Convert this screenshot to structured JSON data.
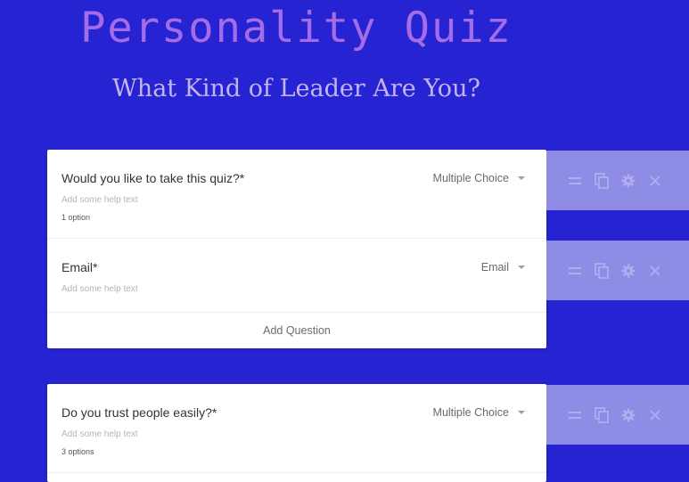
{
  "header": {
    "title": "Personality Quiz",
    "subtitle": "What Kind of Leader Are You?"
  },
  "colors": {
    "background": "#2623d2",
    "title": "#a56ce8",
    "subtitle": "#c4b3f1",
    "toolbar": "#8f8ce6",
    "toolbar_icon": "#b0aef0"
  },
  "pages": [
    {
      "questions": [
        {
          "label": "Would you like to take this quiz?*",
          "type": "Multiple Choice",
          "help_placeholder": "Add some help text",
          "count": "1 option"
        },
        {
          "label": "Email*",
          "type": "Email",
          "help_placeholder": "Add some help text",
          "count": ""
        }
      ],
      "add_question_label": "Add Question"
    },
    {
      "questions": [
        {
          "label": "Do you trust people easily?*",
          "type": "Multiple Choice",
          "help_placeholder": "Add some help text",
          "count": "3 options"
        }
      ]
    }
  ],
  "toolbar_icons": [
    "drag-handle-icon",
    "duplicate-icon",
    "settings-icon",
    "delete-icon"
  ]
}
